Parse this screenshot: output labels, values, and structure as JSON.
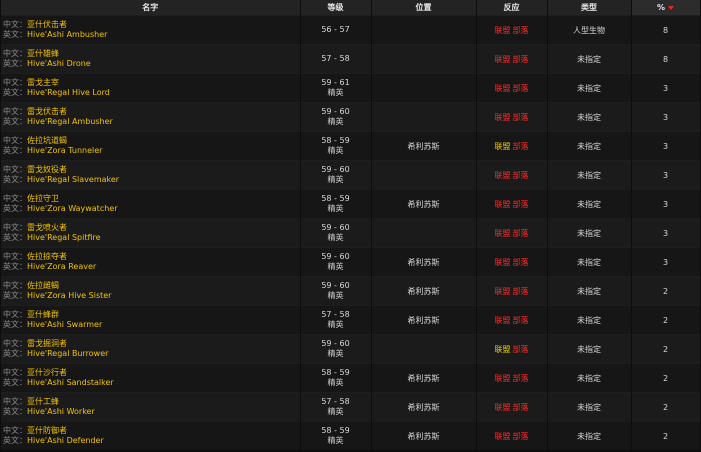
{
  "headers": {
    "name": "名字",
    "level": "等级",
    "location": "位置",
    "reaction": "反应",
    "type": "类型",
    "percent": "%"
  },
  "lang_labels": {
    "cn": "中文：",
    "en": "英文："
  },
  "colors": {
    "hostile": "#ff2a2a",
    "neutral": "#f2d000",
    "name_link": "#f2c200",
    "header_bg": "#232323"
  },
  "rows": [
    {
      "cn": "亚什伏击者",
      "en": "Hive'Ashi Ambusher",
      "level": "56 - 57",
      "class": "",
      "location": "",
      "alliance": "联盟",
      "horde": "部落",
      "reaction": "hostile",
      "type": "人型生物",
      "pct": "8"
    },
    {
      "cn": "亚什雄蜂",
      "en": "Hive'Ashi Drone",
      "level": "57 - 58",
      "class": "",
      "location": "",
      "alliance": "联盟",
      "horde": "部落",
      "reaction": "hostile",
      "type": "未指定",
      "pct": "8"
    },
    {
      "cn": "雷戈主宰",
      "en": "Hive'Regal Hive Lord",
      "level": "59 - 61",
      "class": "精英",
      "location": "",
      "alliance": "联盟",
      "horde": "部落",
      "reaction": "hostile",
      "type": "未指定",
      "pct": "3"
    },
    {
      "cn": "雷戈伏击者",
      "en": "Hive'Regal Ambusher",
      "level": "59 - 60",
      "class": "精英",
      "location": "",
      "alliance": "联盟",
      "horde": "部落",
      "reaction": "hostile",
      "type": "未指定",
      "pct": "3"
    },
    {
      "cn": "佐拉坑道蝎",
      "en": "Hive'Zora Tunneler",
      "level": "58 - 59",
      "class": "精英",
      "location": "希利苏斯",
      "alliance": "联盟",
      "horde": "部落",
      "reaction": "neutral",
      "type": "未指定",
      "pct": "3"
    },
    {
      "cn": "雷戈奴役者",
      "en": "Hive'Regal Slavemaker",
      "level": "59 - 60",
      "class": "精英",
      "location": "",
      "alliance": "联盟",
      "horde": "部落",
      "reaction": "hostile",
      "type": "未指定",
      "pct": "3"
    },
    {
      "cn": "佐拉守卫",
      "en": "Hive'Zora Waywatcher",
      "level": "58 - 59",
      "class": "精英",
      "location": "希利苏斯",
      "alliance": "联盟",
      "horde": "部落",
      "reaction": "hostile",
      "type": "未指定",
      "pct": "3"
    },
    {
      "cn": "雷戈喷火者",
      "en": "Hive'Regal Spitfire",
      "level": "59 - 60",
      "class": "精英",
      "location": "",
      "alliance": "联盟",
      "horde": "部落",
      "reaction": "hostile",
      "type": "未指定",
      "pct": "3"
    },
    {
      "cn": "佐拉掠夺者",
      "en": "Hive'Zora Reaver",
      "level": "59 - 60",
      "class": "精英",
      "location": "希利苏斯",
      "alliance": "联盟",
      "horde": "部落",
      "reaction": "hostile",
      "type": "未指定",
      "pct": "3"
    },
    {
      "cn": "佐拉雌蝎",
      "en": "Hive'Zora Hive Sister",
      "level": "59 - 60",
      "class": "精英",
      "location": "希利苏斯",
      "alliance": "联盟",
      "horde": "部落",
      "reaction": "hostile",
      "type": "未指定",
      "pct": "2"
    },
    {
      "cn": "亚什蜂群",
      "en": "Hive'Ashi Swarmer",
      "level": "57 - 58",
      "class": "精英",
      "location": "希利苏斯",
      "alliance": "联盟",
      "horde": "部落",
      "reaction": "hostile",
      "type": "未指定",
      "pct": "2"
    },
    {
      "cn": "雷戈掘洞者",
      "en": "Hive'Regal Burrower",
      "level": "59 - 60",
      "class": "精英",
      "location": "",
      "alliance": "联盟",
      "horde": "部落",
      "reaction": "neutral",
      "type": "未指定",
      "pct": "2"
    },
    {
      "cn": "亚什沙行者",
      "en": "Hive'Ashi Sandstalker",
      "level": "58 - 59",
      "class": "精英",
      "location": "希利苏斯",
      "alliance": "联盟",
      "horde": "部落",
      "reaction": "hostile",
      "type": "未指定",
      "pct": "2"
    },
    {
      "cn": "亚什工蜂",
      "en": "Hive'Ashi Worker",
      "level": "57 - 58",
      "class": "精英",
      "location": "希利苏斯",
      "alliance": "联盟",
      "horde": "部落",
      "reaction": "hostile",
      "type": "未指定",
      "pct": "2"
    },
    {
      "cn": "亚什防御者",
      "en": "Hive'Ashi Defender",
      "level": "58 - 59",
      "class": "精英",
      "location": "希利苏斯",
      "alliance": "联盟",
      "horde": "部落",
      "reaction": "hostile",
      "type": "未指定",
      "pct": "2"
    }
  ]
}
